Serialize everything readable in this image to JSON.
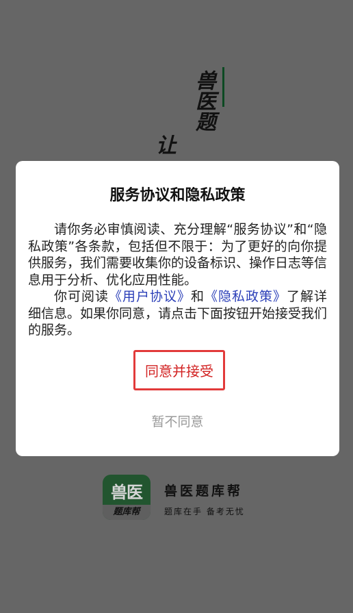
{
  "splash": {
    "slogan_col1": "兽医题",
    "slogan_col2": "让"
  },
  "dialog": {
    "title": "服务协议和隐私政策",
    "para1": "请你务必审慎阅读、充分理解“服务协议”和“隐私政策”各条款，包括但不限于：为了更好的向你提供服务，我们需要收集你的设备标识、操作日志等信息用于分析、优化应用性能。",
    "para2_prefix": "你可阅读",
    "link_user_agreement": "《用户协议》",
    "para2_and": "和",
    "link_privacy_policy": "《隐私政策》",
    "para2_suffix": "了解详细信息。如果你同意，请点击下面按钮开始接受我们的服务。",
    "agree_label": "同意并接受",
    "disagree_label": "暂不同意"
  },
  "brand": {
    "logo_top": "兽医",
    "logo_bottom": "题库帮",
    "name": "兽医题库帮",
    "tagline": "题库在手 备考无忧"
  },
  "colors": {
    "overlay": "#666666",
    "accent_red": "#e23a3a",
    "link_blue": "#2b3fb8",
    "brand_green": "#22552f"
  }
}
